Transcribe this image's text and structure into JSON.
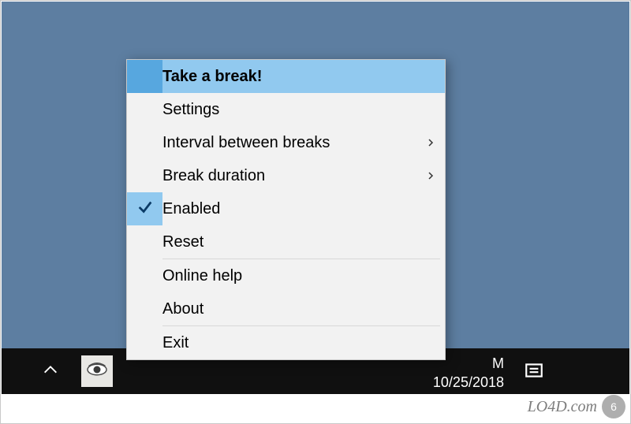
{
  "menu": {
    "take_break": "Take a break!",
    "settings": "Settings",
    "interval": "Interval between breaks",
    "duration": "Break duration",
    "enabled": "Enabled",
    "reset": "Reset",
    "help": "Online help",
    "about": "About",
    "exit": "Exit"
  },
  "taskbar": {
    "time": "M",
    "date": "10/25/2018"
  },
  "watermark": {
    "text": "LO4D.com",
    "count": "6"
  }
}
